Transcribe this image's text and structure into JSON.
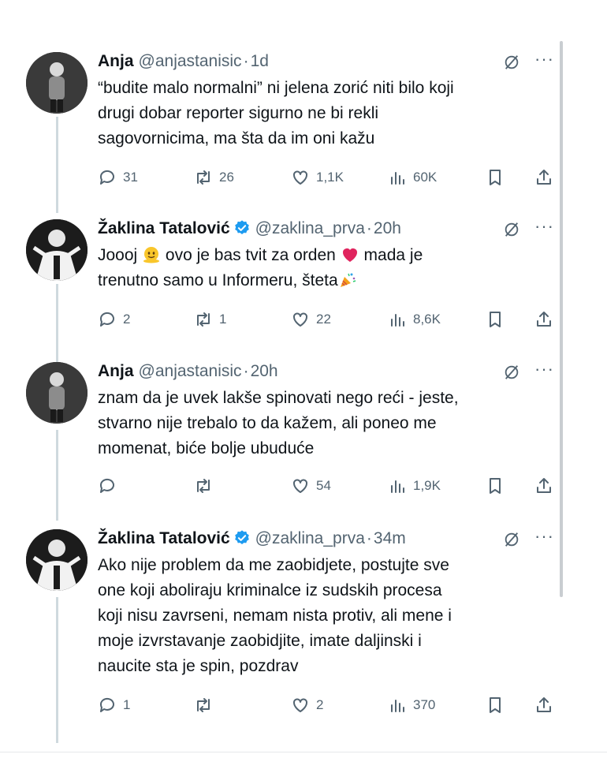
{
  "tweets": [
    {
      "name": "Anja",
      "verified": false,
      "handle": "@anjastanisic",
      "sep": "·",
      "time": "1d",
      "lines": [
        "“budite malo normalni” ni jelena zorić niti bilo koji",
        "drugi dobar reporter sigurno ne bi rekli",
        "sagovornicima, ma šta da im oni kažu"
      ],
      "replies": "31",
      "retweets": "26",
      "likes": "1,1K",
      "views": "60K"
    },
    {
      "name": "Žaklina Tatalović",
      "verified": true,
      "handle": "@zaklina_prva",
      "sep": "·",
      "time": "20h",
      "line1_a": "Joooj",
      "line1_b": "ovo je bas tvit za orden",
      "line1_c": "mada je",
      "line2_a": "trenutno samo u Informeru, šteta",
      "replies": "2",
      "retweets": "1",
      "likes": "22",
      "views": "8,6K"
    },
    {
      "name": "Anja",
      "verified": false,
      "handle": "@anjastanisic",
      "sep": "·",
      "time": "20h",
      "lines": [
        "znam da je uvek lakše spinovati nego reći - jeste,",
        "stvarno nije trebalo to da kažem, ali poneo me",
        "momenat, biće bolje ubuduće"
      ],
      "replies": "",
      "retweets": "",
      "likes": "54",
      "views": "1,9K"
    },
    {
      "name": "Žaklina Tatalović",
      "verified": true,
      "handle": "@zaklina_prva",
      "sep": "·",
      "time": "34m",
      "lines": [
        "Ako nije problem da me zaobidjete, postujte sve",
        "one koji aboliraju kriminalce iz sudskih procesa",
        "koji nisu zavrseni, nemam nista protiv, ali mene i",
        "moje izvrstavanje zaobidjite, imate daljinski i",
        "naucite sta je spin, pozdrav"
      ],
      "replies": "1",
      "retweets": "",
      "likes": "2",
      "views": "370"
    }
  ],
  "colors": {
    "text": "#0f1419",
    "secondary": "#536471",
    "verified": "#1d9bf0",
    "connector": "#cfd9de",
    "heart_emoji": "#e0245e"
  },
  "icons": [
    "reply-icon",
    "retweet-icon",
    "like-icon",
    "views-icon",
    "bookmark-icon",
    "share-icon",
    "grok-icon",
    "more-icon",
    "verified-icon"
  ]
}
